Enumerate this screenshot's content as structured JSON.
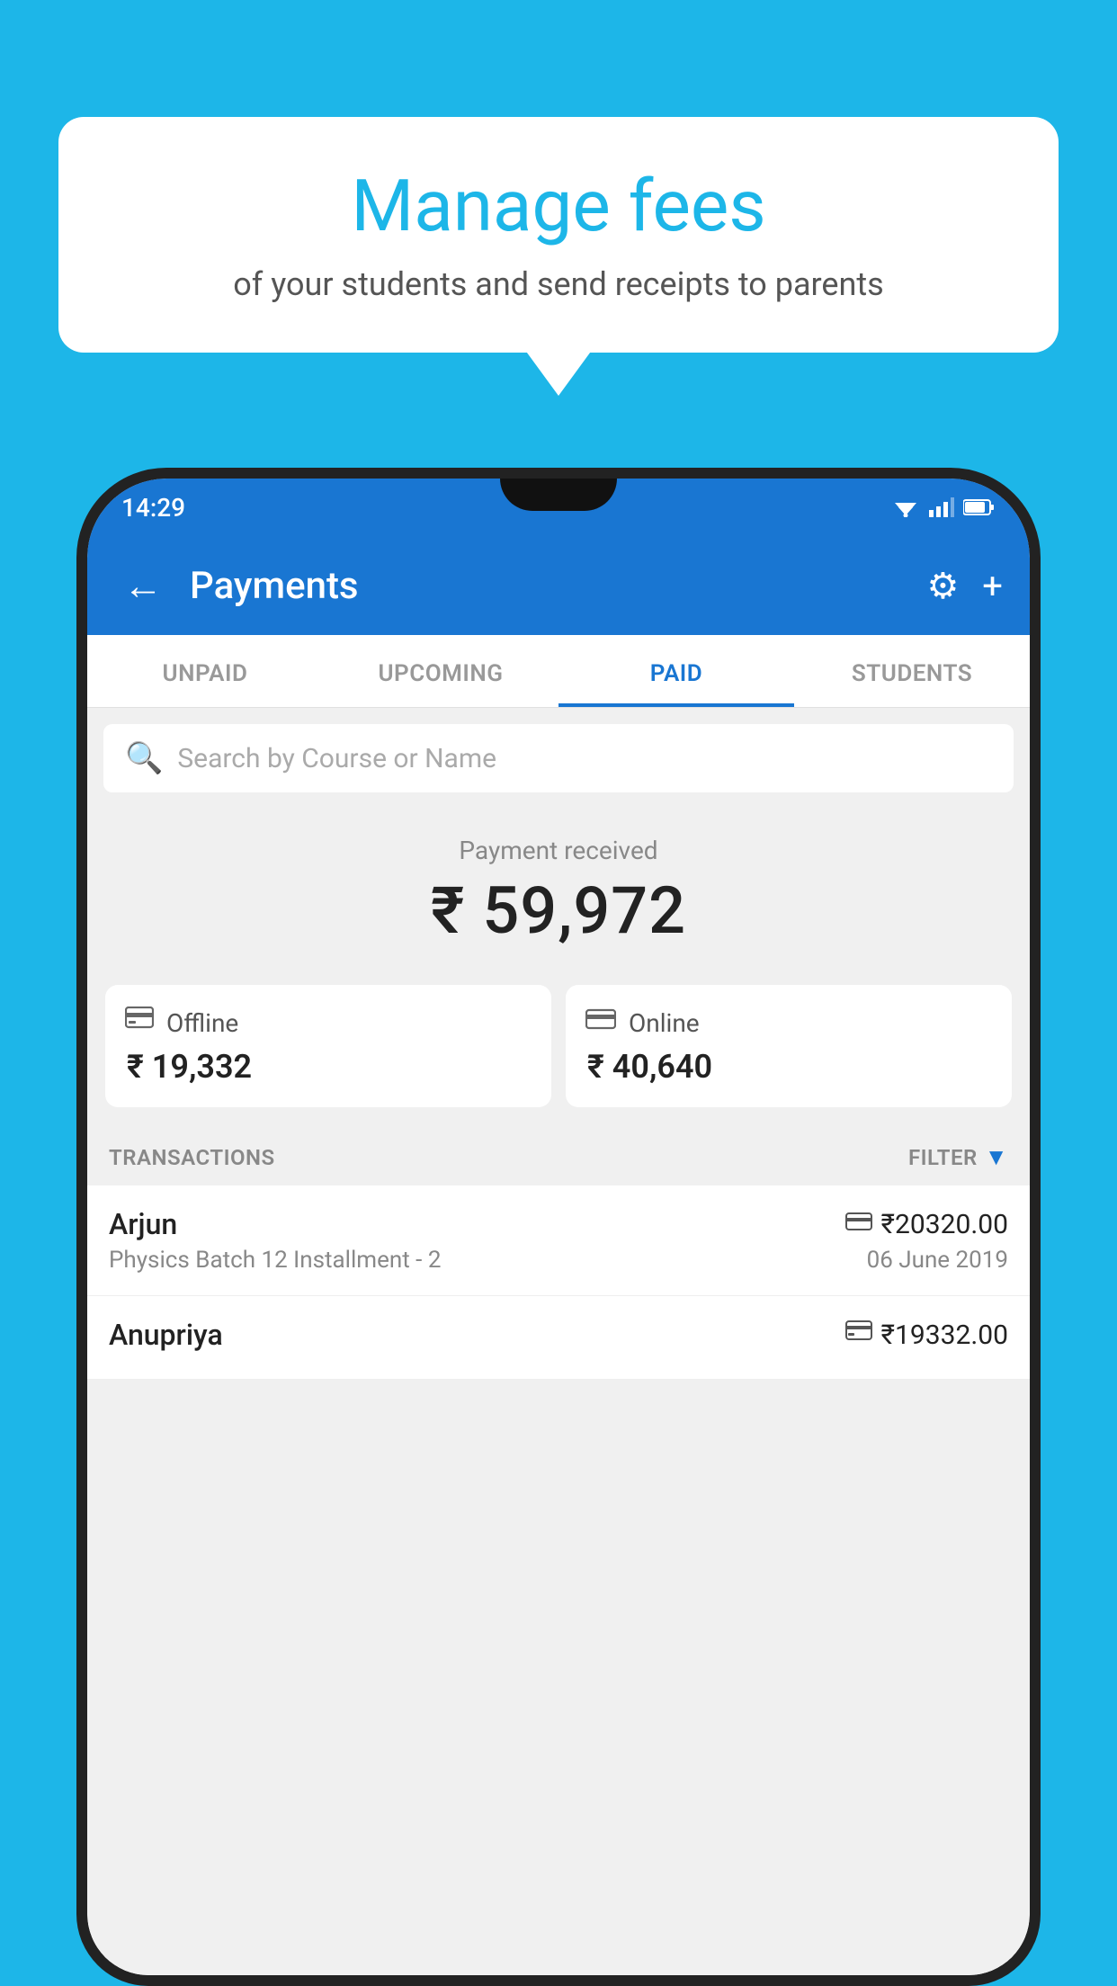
{
  "background": {
    "color": "#1DB6E8"
  },
  "speech_bubble": {
    "title": "Manage fees",
    "subtitle": "of your students and send receipts to parents"
  },
  "status_bar": {
    "time": "14:29"
  },
  "app_bar": {
    "title": "Payments",
    "back_label": "←",
    "settings_label": "⚙",
    "add_label": "+"
  },
  "tabs": [
    {
      "label": "UNPAID",
      "active": false
    },
    {
      "label": "UPCOMING",
      "active": false
    },
    {
      "label": "PAID",
      "active": true
    },
    {
      "label": "STUDENTS",
      "active": false
    }
  ],
  "search": {
    "placeholder": "Search by Course or Name"
  },
  "payment_received": {
    "label": "Payment received",
    "amount": "₹ 59,972"
  },
  "payment_cards": [
    {
      "icon": "💳",
      "label": "Offline",
      "amount": "₹ 19,332"
    },
    {
      "icon": "💳",
      "label": "Online",
      "amount": "₹ 40,640"
    }
  ],
  "transactions": {
    "header_label": "TRANSACTIONS",
    "filter_label": "FILTER",
    "items": [
      {
        "name": "Arjun",
        "course": "Physics Batch 12 Installment - 2",
        "amount": "₹20320.00",
        "date": "06 June 2019",
        "type": "online"
      },
      {
        "name": "Anupriya",
        "course": "",
        "amount": "₹19332.00",
        "date": "",
        "type": "offline"
      }
    ]
  }
}
